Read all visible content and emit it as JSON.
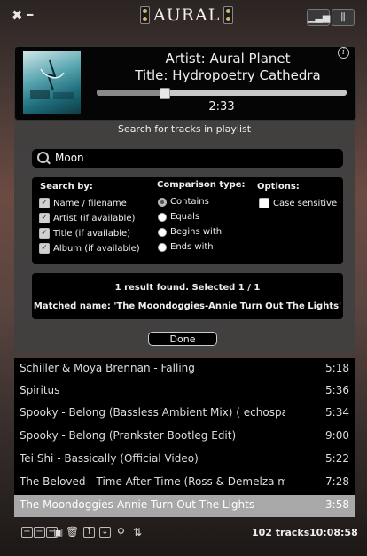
{
  "app": {
    "name": "AURAL"
  },
  "titlebar": {
    "close_glyph": "✖",
    "minimize_glyph": "━",
    "icon_left": "eq-layout-icon",
    "icon_right": "sliders-icon"
  },
  "now_playing": {
    "artist": "Artist: Aural Planet",
    "title": "Title: Hydropoetry Cathedra",
    "elapsed": "2:33",
    "progress_fraction": 0.27
  },
  "search_dialog": {
    "heading": "Search for tracks in playlist",
    "query": "Moon",
    "search_by_heading": "Search by:",
    "search_by": [
      {
        "label": "Name / filename",
        "checked": true
      },
      {
        "label": "Artist (if available)",
        "checked": true
      },
      {
        "label": "Title (if available)",
        "checked": true
      },
      {
        "label": "Album (if available)",
        "checked": true
      }
    ],
    "comparison_heading": "Comparison type:",
    "comparison": [
      {
        "label": "Contains",
        "selected": true
      },
      {
        "label": "Equals",
        "selected": false
      },
      {
        "label": "Begins with",
        "selected": false
      },
      {
        "label": "Ends with",
        "selected": false
      }
    ],
    "options_heading": "Options:",
    "options": [
      {
        "label": "Case sensitive",
        "checked": false
      }
    ],
    "result_summary": "1 result found. Selected 1 / 1",
    "matched_name": "Matched name: 'The Moondoggies-Annie Turn Out The Lights'",
    "done_label": "Done"
  },
  "playlist": {
    "tracks": [
      {
        "name": "Schiller & Moya Brennan - Falling",
        "duration": "5:18",
        "selected": false
      },
      {
        "name": "Spiritus",
        "duration": "5:36",
        "selected": false
      },
      {
        "name": "Spooky - Belong (Bassless Ambient Mix) ( echospac…",
        "duration": "5:34",
        "selected": false
      },
      {
        "name": "Spooky - Belong (Prankster Bootleg Edit)",
        "duration": "9:00",
        "selected": false
      },
      {
        "name": "Tei Shi - Bassically (Official Video)",
        "duration": "5:22",
        "selected": false
      },
      {
        "name": "The Beloved - Time After Time (Ross & Demelza mix)",
        "duration": "7:28",
        "selected": false
      },
      {
        "name": "The Moondoggies-Annie Turn Out The Lights",
        "duration": "3:58",
        "selected": true
      }
    ],
    "track_count": "102 tracks",
    "total_duration": "10:08:58"
  },
  "colors": {
    "selected_row": "#a8a8a8",
    "panel_bg": "#000000",
    "dialog_bg": "#404040"
  }
}
